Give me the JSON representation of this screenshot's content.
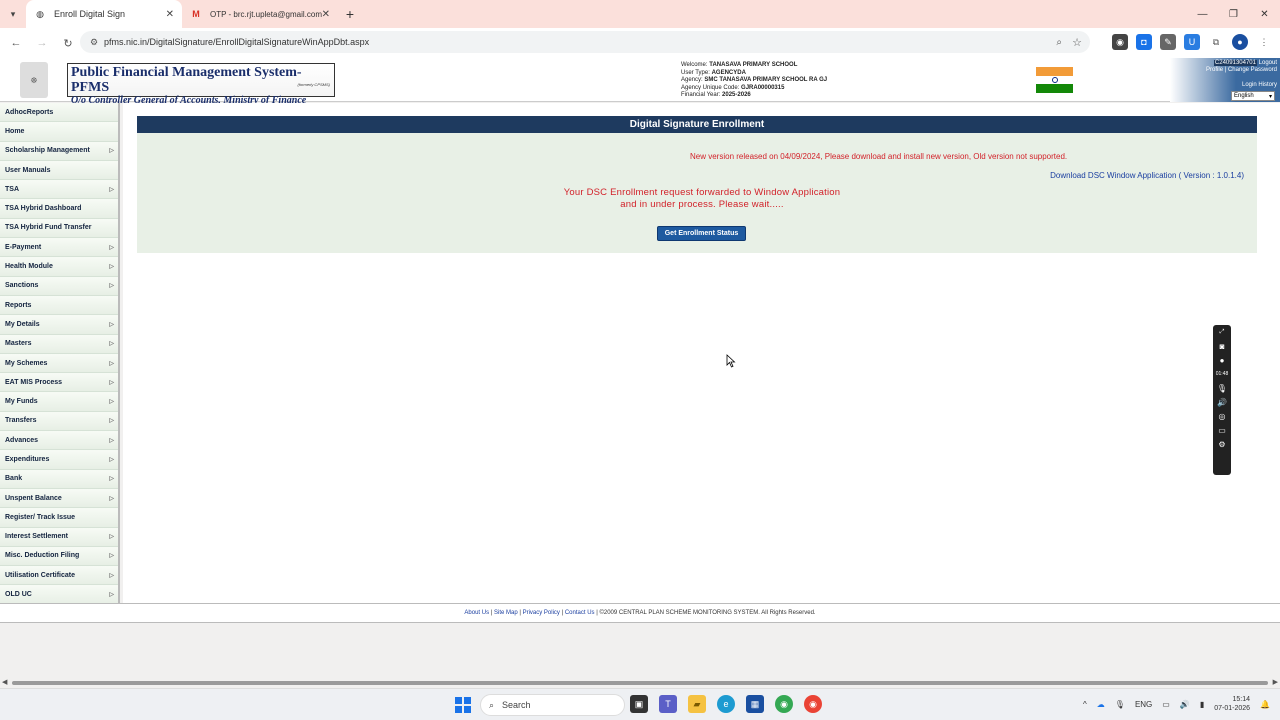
{
  "browser": {
    "tabs": [
      {
        "title": "Enroll Digital Sign",
        "active": true,
        "favicon": "globe-icon"
      },
      {
        "title": "OTP - brc.rjt.upleta@gmail.com",
        "active": false,
        "favicon": "gmail-icon"
      }
    ],
    "url": "pfms.nic.in/DigitalSignature/EnrollDigitalSignatureWinAppDbt.aspx"
  },
  "header": {
    "logo_title": "Public Financial Management System-PFMS",
    "logo_formerly": "(formerly CPSMS)",
    "logo_subtitle": "O/o Controller General of Accounts, Ministry of Finance",
    "welcome_label": "Welcome:",
    "welcome_value": "TANASAVA PRIMARY SCHOOL",
    "user_type_label": "User Type:",
    "user_type_value": "AGENCYDA",
    "agency_label": "Agency:",
    "agency_value": "SMC TANASAVA PRIMARY SCHOOL RA GJ",
    "agency_code_label": "Agency Unique Code:",
    "agency_code_value": "GJRA00000315",
    "fy_label": "Financial Year:",
    "fy_value": "2025-2026",
    "user_id": "C24091304701",
    "logout": "Logout",
    "profile": "Profile",
    "separator": "|",
    "change_password": "Change Password",
    "login_history": "Login History",
    "language": "English"
  },
  "sidebar": {
    "items": [
      {
        "label": "AdhocReports",
        "arrow": false
      },
      {
        "label": "Home",
        "arrow": false
      },
      {
        "label": "Scholarship Management",
        "arrow": true
      },
      {
        "label": "User Manuals",
        "arrow": false
      },
      {
        "label": "TSA",
        "arrow": true
      },
      {
        "label": "TSA Hybrid Dashboard",
        "arrow": false
      },
      {
        "label": "TSA Hybrid Fund Transfer",
        "arrow": false
      },
      {
        "label": "E-Payment",
        "arrow": true
      },
      {
        "label": "Health Module",
        "arrow": true
      },
      {
        "label": "Sanctions",
        "arrow": true
      },
      {
        "label": "Reports",
        "arrow": false
      },
      {
        "label": "My Details",
        "arrow": true
      },
      {
        "label": "Masters",
        "arrow": true
      },
      {
        "label": "My Schemes",
        "arrow": true
      },
      {
        "label": "EAT MIS Process",
        "arrow": true
      },
      {
        "label": "My Funds",
        "arrow": true
      },
      {
        "label": "Transfers",
        "arrow": true
      },
      {
        "label": "Advances",
        "arrow": true
      },
      {
        "label": "Expenditures",
        "arrow": true
      },
      {
        "label": "Bank",
        "arrow": true
      },
      {
        "label": "Unspent Balance",
        "arrow": true
      },
      {
        "label": "Register/ Track Issue",
        "arrow": false
      },
      {
        "label": "Interest Settlement",
        "arrow": true
      },
      {
        "label": "Misc. Deduction Filing",
        "arrow": true
      },
      {
        "label": "Utilisation Certificate",
        "arrow": true
      },
      {
        "label": "OLD UC",
        "arrow": true
      }
    ]
  },
  "main": {
    "panel_title": "Digital Signature Enrollment",
    "new_version_notice": "New version released on 04/09/2024, Please download and install new version, Old version not supported.",
    "download_link": "Download DSC Window Application ( Version : 1.0.1.4)",
    "status_line1": "Your DSC Enrollment request forwarded to Window Application",
    "status_line2": "and in under process. Please wait.....",
    "status_button": "Get Enrollment Status"
  },
  "recorder": {
    "timer": "01:48"
  },
  "footer": {
    "about": "About Us",
    "sitemap": "Site Map",
    "privacy": "Privacy Policy",
    "contact": "Contact Us",
    "separator": "|",
    "copyright": "©2009 CENTRAL PLAN SCHEME MONITORING SYSTEM. All Rights Reserved."
  },
  "taskbar": {
    "search": "Search",
    "lang": "ENG",
    "time": "15:14",
    "date": "07-01-2026"
  },
  "colors": {
    "panel_header": "#1e3a5f",
    "alert_red": "#d2222a",
    "link_blue": "#1a3ea0",
    "tab_strip": "#fbe0db"
  }
}
